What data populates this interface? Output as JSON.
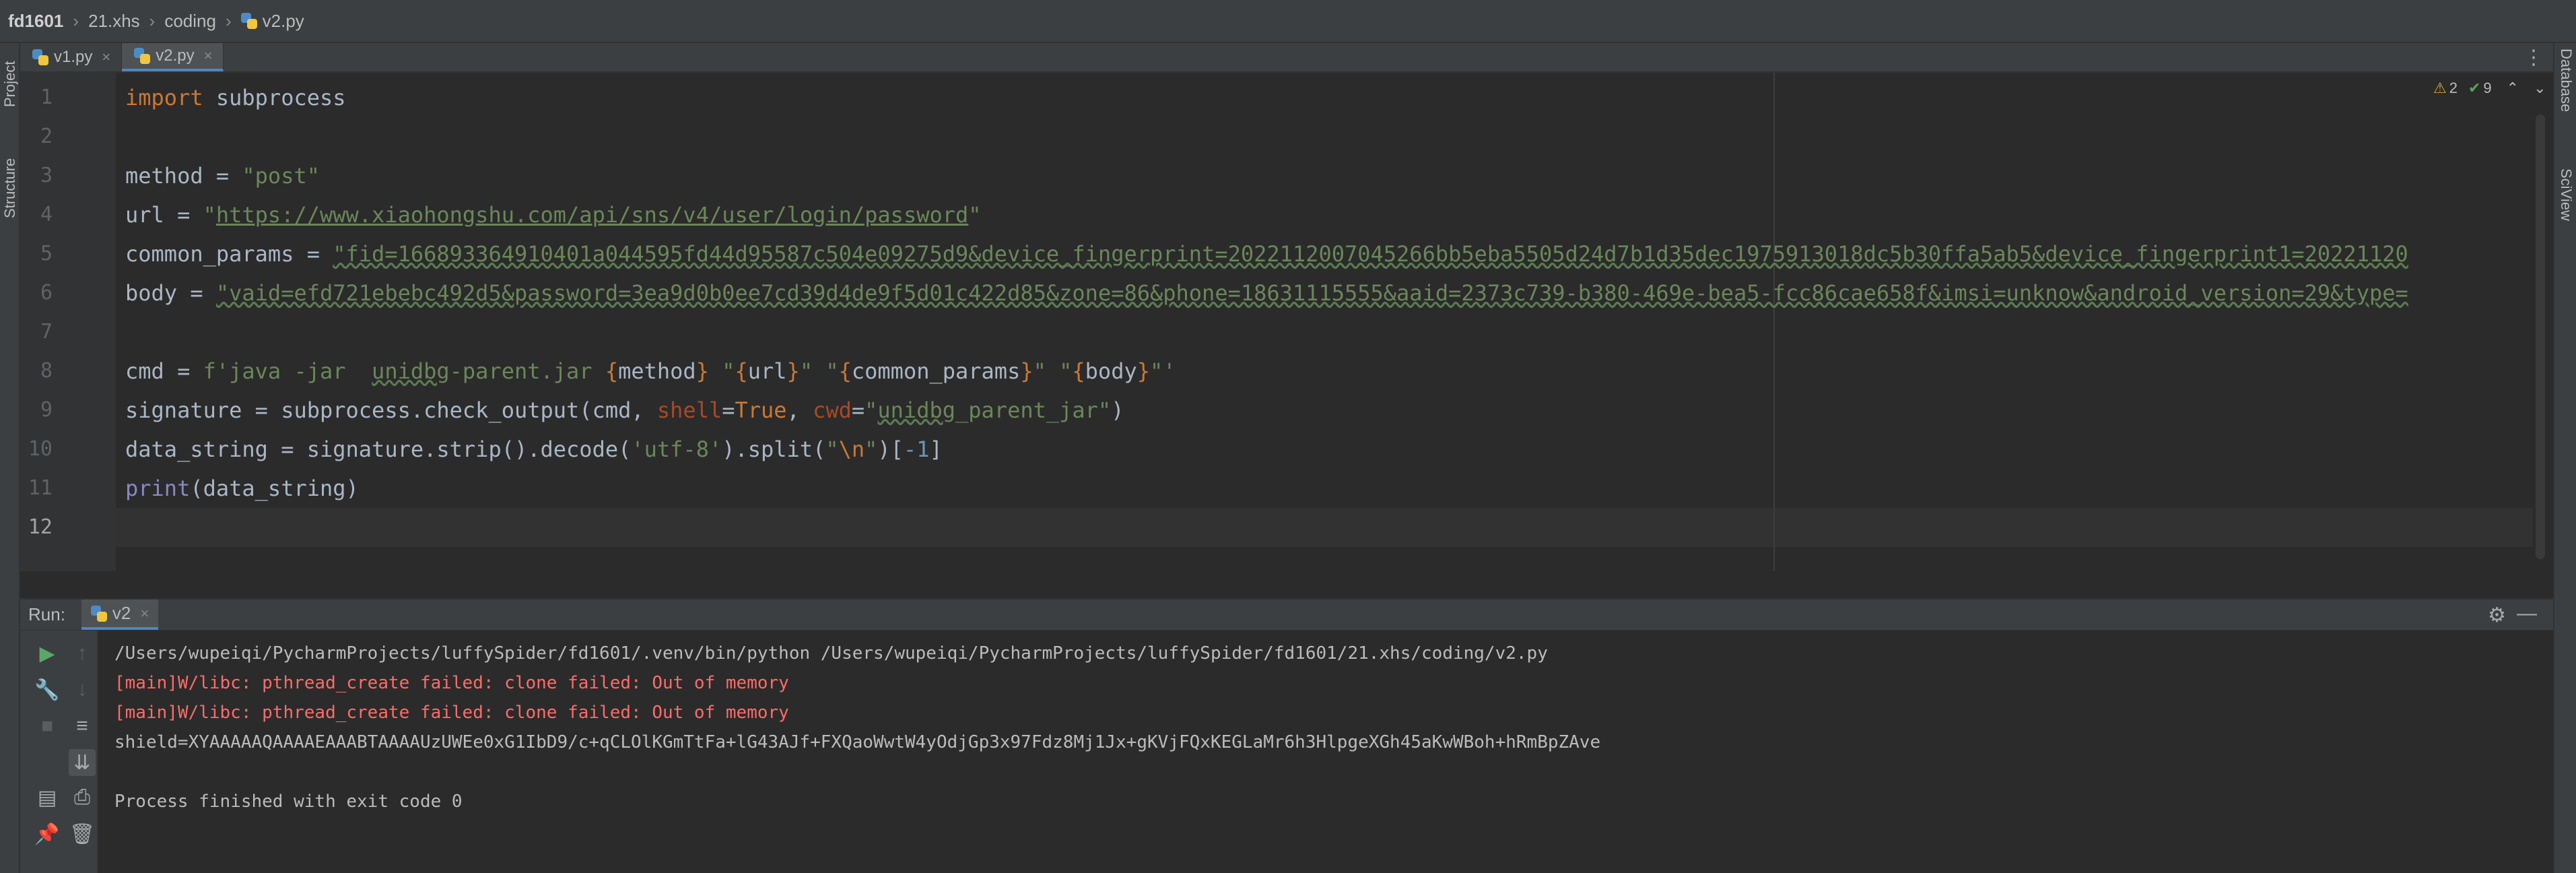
{
  "breadcrumb": [
    "fd1601",
    "21.xhs",
    "coding",
    "v2.py"
  ],
  "left_tools": [
    "Project",
    "Structure"
  ],
  "right_tools": [
    "Database",
    "SciView"
  ],
  "tabs": [
    {
      "label": "v1.py",
      "active": false
    },
    {
      "label": "v2.py",
      "active": true
    }
  ],
  "inspections": {
    "warnings": "2",
    "ok": "9"
  },
  "line_numbers": [
    "1",
    "2",
    "3",
    "4",
    "5",
    "6",
    "7",
    "8",
    "9",
    "10",
    "11",
    "12"
  ],
  "code": {
    "l1_kw": "import",
    "l1_mod": " subprocess",
    "l3_var": "method = ",
    "l3_val": "\"post\"",
    "l4_var": "url = ",
    "l4_q1": "\"",
    "l4_url": "https://www.xiaohongshu.com/api/sns/v4/user/login/password",
    "l4_q2": "\"",
    "l5_var": "common_params = ",
    "l5_val": "\"fid=166893364910401a044595fd44d95587c504e09275d9&device_fingerprint=20221120070452​66bb5eba5505d24d7b1d35dec1975913018dc5b30ffa5ab5&device_fingerprint1=20221120",
    "l6_var": "body = ",
    "l6_val": "\"vaid=efd721ebebc492d5&password=3ea9d0b0ee7cd39d4de9f5d01c422d85&zone=86&phone=18631115555&aaid=2373c739-b380-469e-bea5-fcc86cae658f&imsi=unknow&android_version=29&type=",
    "l8_var": "cmd = ",
    "l8_f": "f'java -jar  ",
    "l8_jar": "unidbg",
    "l8_rest": "-parent.jar ",
    "l8_b1": "{",
    "l8_method": "method",
    "l8_b2": "}",
    "l8_s2": " \"",
    "l8_b3": "{",
    "l8_url": "url",
    "l8_b4": "}",
    "l8_s3": "\" \"",
    "l8_b5": "{",
    "l8_cp": "common_params",
    "l8_b6": "}",
    "l8_s4": "\" \"",
    "l8_b7": "{",
    "l8_body": "body",
    "l8_b8": "}",
    "l8_s5": "\"'",
    "l9_a": "signature = subprocess.check_output(cmd, ",
    "l9_shell": "shell",
    "l9_eq1": "=",
    "l9_true": "True",
    "l9_comma": ", ",
    "l9_cwd": "cwd",
    "l9_eq2": "=",
    "l9_q": "\"",
    "l9_dir": "unidbg",
    "l9_dir2": "_parent_jar\"",
    "l9_close": ")",
    "l10_a": "data_string = signature.strip().decode(",
    "l10_utf": "'utf-8'",
    "l10_b": ").split(",
    "l10_q1": "\"",
    "l10_esc": "\\n",
    "l10_q2": "\"",
    "l10_c": ")[",
    "l10_num": "-1",
    "l10_d": "]",
    "l11_print": "print",
    "l11_rest": "(data_string)"
  },
  "run": {
    "label": "Run:",
    "tab": "v2",
    "output": [
      {
        "text": "/Users/wupeiqi/PycharmProjects/luffySpider/fd1601/.venv/bin/python /Users/wupeiqi/PycharmProjects/luffySpider/fd1601/21.xhs/coding/v2.py",
        "type": "normal"
      },
      {
        "text": "[main]W/libc: pthread_create failed: clone failed: Out of memory",
        "type": "error"
      },
      {
        "text": "[main]W/libc: pthread_create failed: clone failed: Out of memory",
        "type": "error"
      },
      {
        "text": "shield=XYAAAAAQAAAAEAAABTAAAAUzUWEe0xG1IbD9/c+qCLOlKGmTtFa+lG43AJf+FXQaoWwtW4yOdjGp3x97Fdz8Mj1Jx+gKVjFQxKEGLaMr6h3HlpgeXGh45aKwWBoh+hRmBpZAve",
        "type": "normal"
      },
      {
        "text": "",
        "type": "normal"
      },
      {
        "text": "Process finished with exit code 0",
        "type": "normal"
      }
    ]
  },
  "colors": {
    "accent": "#4a88c7",
    "error": "#ff6b68",
    "keyword": "#cc7832",
    "string": "#6a8759",
    "number": "#6897bb"
  }
}
